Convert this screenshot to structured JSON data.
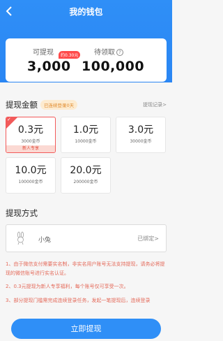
{
  "header": {
    "title": "我的钱包",
    "back_icon": "back-arrow-icon"
  },
  "balance": {
    "withdrawable_label": "可提现",
    "withdrawable_value": "3,000",
    "approx_badge": "约0.30元",
    "pending_label": "待领取",
    "pending_value": "100,000",
    "help_glyph": "?"
  },
  "amount_section": {
    "title": "提现金额",
    "streak_badge": "已连续登录0天",
    "record_link": "提现记录>",
    "options": [
      {
        "amount": "0.3元",
        "coins": "3000金币",
        "tag": "新人专享",
        "selected": true
      },
      {
        "amount": "1.0元",
        "coins": "10000金币"
      },
      {
        "amount": "3.0元",
        "coins": "30000金币"
      },
      {
        "amount": "10.0元",
        "coins": "100000金币"
      },
      {
        "amount": "20.0元",
        "coins": "200000金币"
      }
    ]
  },
  "method_section": {
    "title": "提现方式",
    "account_name": "小兔",
    "status": "已绑定>"
  },
  "notes": [
    "1、由于微信支付需要实名制，非实名用户账号无法支持提现，请务必将提现的微信账号进行实名认证。",
    "2、0.3元提现为新人专享福利，每个账号仅可享受一次。",
    "3、部分提现门槛需完成连续登录任务，发起一笔提现后，连续登录"
  ],
  "footer": {
    "withdraw_button": "立即提现"
  },
  "colors": {
    "primary": "#2f8ff7",
    "accent_red": "#f25a5a",
    "note_red": "#e46a5a"
  }
}
